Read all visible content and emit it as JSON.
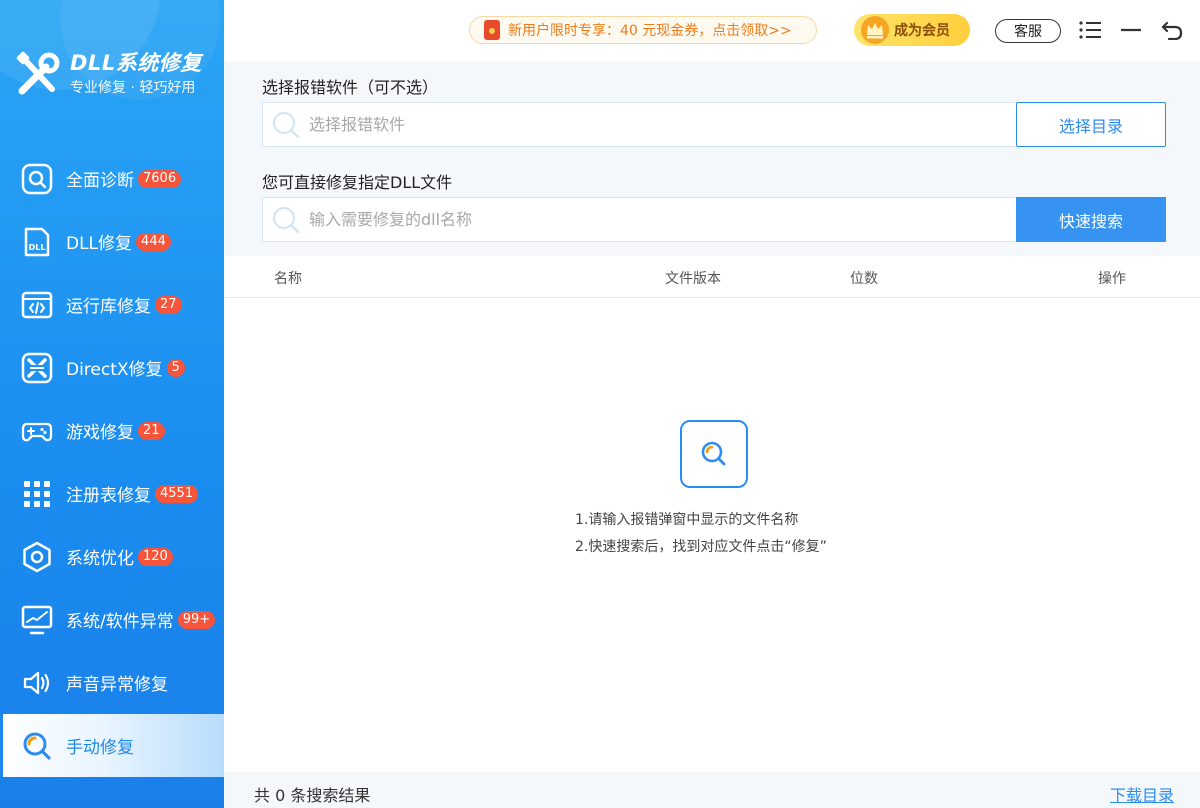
{
  "app": {
    "name": "DLL系统修复",
    "slogan": "专业修复 · 轻巧好用"
  },
  "header": {
    "promo": "新用户限时专享：40 元现金券，点击领取>>",
    "vip_label": "成为会员",
    "service_label": "客服"
  },
  "sidebar": {
    "items": [
      {
        "label": "全面诊断",
        "badge": "7606",
        "icon": "scan-icon"
      },
      {
        "label": "DLL修复",
        "badge": "444",
        "icon": "dll-file-icon"
      },
      {
        "label": "运行库修复",
        "badge": "27",
        "icon": "runtime-code-icon"
      },
      {
        "label": "DirectX修复",
        "badge": "5",
        "icon": "directx-icon"
      },
      {
        "label": "游戏修复",
        "badge": "21",
        "icon": "gamepad-icon"
      },
      {
        "label": "注册表修复",
        "badge": "4551",
        "icon": "grid-icon"
      },
      {
        "label": "系统优化",
        "badge": "120",
        "icon": "hexagon-icon"
      },
      {
        "label": "系统/软件异常",
        "badge": "99+",
        "icon": "monitor-icon"
      },
      {
        "label": "声音异常修复",
        "badge": "",
        "icon": "speaker-icon"
      },
      {
        "label": "手动修复",
        "badge": "",
        "icon": "manual-search-icon",
        "active": true
      }
    ]
  },
  "search": {
    "software_label": "选择报错软件（可不选）",
    "software_placeholder": "选择报错软件",
    "choose_dir_button": "选择目录",
    "dll_label": "您可直接修复指定DLL文件",
    "dll_placeholder": "输入需要修复的dll名称",
    "search_button": "快速搜索"
  },
  "table": {
    "columns": [
      "名称",
      "文件版本",
      "位数",
      "操作"
    ]
  },
  "empty_state": {
    "hint1": "1.请输入报错弹窗中显示的文件名称",
    "hint2": "2.快速搜索后，找到对应文件点击“修复”"
  },
  "footer": {
    "result_count": "共 0 条搜索结果",
    "download_link": "下载目录"
  },
  "colors": {
    "accent": "#2d8cf0",
    "sidebar": "#1b8ef0",
    "badge": "#f6543b",
    "promo_text": "#f07a19"
  }
}
